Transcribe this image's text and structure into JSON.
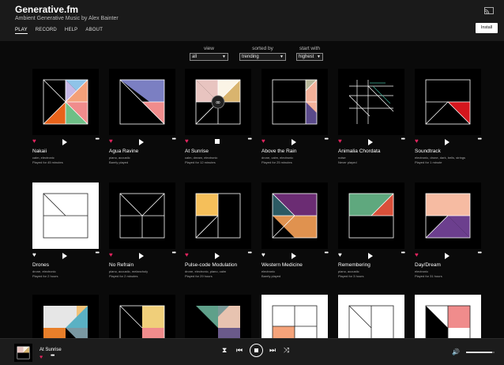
{
  "app": {
    "title": "Generative.fm",
    "subtitle": "Ambient Generative Music by Alex Bainter",
    "install_label": "Install"
  },
  "nav": [
    {
      "label": "PLAY",
      "active": true
    },
    {
      "label": "RECORD",
      "active": false
    },
    {
      "label": "HELP",
      "active": false
    },
    {
      "label": "ABOUT",
      "active": false
    }
  ],
  "filters": {
    "view": {
      "label": "view",
      "value": "all"
    },
    "sorted_by": {
      "label": "sorted by",
      "value": "trending"
    },
    "start_with": {
      "label": "start with",
      "value": "highest"
    }
  },
  "pieces": [
    {
      "title": "Nakaii",
      "tags": "calm, electronic",
      "played": "Played for 45 minutes",
      "favorite": true,
      "playing": false
    },
    {
      "title": "Agua Ravine",
      "tags": "piano, acoustic",
      "played": "Barely played",
      "favorite": true,
      "playing": false
    },
    {
      "title": "At Sunrise",
      "tags": "calm, dream, electronic",
      "played": "Played for 12 minutes",
      "favorite": true,
      "playing": true
    },
    {
      "title": "Above the Rain",
      "tags": "drone, calm, electronic",
      "played": "Played for 25 minutes",
      "favorite": true,
      "playing": false
    },
    {
      "title": "Animalia Chordata",
      "tags": "noise",
      "played": "Never played",
      "favorite": true,
      "playing": false
    },
    {
      "title": "Soundtrack",
      "tags": "electronic, drone, dark, bells, strings",
      "played": "Played for 1 minute",
      "favorite": true,
      "playing": false
    },
    {
      "title": "Drones",
      "tags": "drone, electronic",
      "played": "Played for 2 hours",
      "favorite": false,
      "playing": false
    },
    {
      "title": "No Refrain",
      "tags": "piano, acoustic, melancholy",
      "played": "Played for 2 minutes",
      "favorite": true,
      "playing": false
    },
    {
      "title": "Pulse-code Modulation",
      "tags": "drone, electronic, piano, calm",
      "played": "Played for 29 hours",
      "favorite": true,
      "playing": false
    },
    {
      "title": "Western Medicine",
      "tags": "electronic",
      "played": "Barely played",
      "favorite": false,
      "playing": false
    },
    {
      "title": "Remembering",
      "tags": "piano, acoustic",
      "played": "Played for 3 hours",
      "favorite": false,
      "playing": false
    },
    {
      "title": "Day/Dream",
      "tags": "electronic",
      "played": "Played for 31 hours",
      "favorite": true,
      "playing": false
    }
  ],
  "now_playing": {
    "title": "At Sunrise",
    "favorite": true,
    "volume_fraction": 0.92
  },
  "icons": {
    "cast": "cast-icon",
    "heart": "heart-icon",
    "play": "play-icon",
    "stop": "stop-icon",
    "more": "more-icon",
    "timer": "hourglass-icon",
    "previous": "previous-icon",
    "next": "next-icon",
    "shuffle": "shuffle-icon",
    "volume": "volume-icon"
  },
  "colors": {
    "background": "#0a0a0a",
    "header": "#1a1a1a",
    "favorite": "#e0245e"
  }
}
